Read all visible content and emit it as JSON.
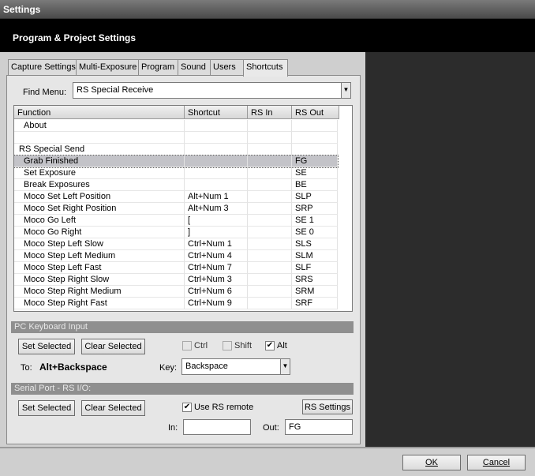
{
  "window": {
    "title": "Settings"
  },
  "header": {
    "title": "Program & Project Settings"
  },
  "tabs": [
    {
      "label": "Capture Settings"
    },
    {
      "label": "Multi-Exposure"
    },
    {
      "label": "Program"
    },
    {
      "label": "Sound"
    },
    {
      "label": "Users"
    },
    {
      "label": "Shortcuts"
    }
  ],
  "active_tab": "Shortcuts",
  "find_menu": {
    "label": "Find Menu:",
    "value": "RS Special Receive"
  },
  "grid": {
    "columns": [
      "Function",
      "Shortcut",
      "RS In",
      "RS Out"
    ],
    "rows": [
      {
        "function": "About",
        "shortcut": "",
        "rs_in": "",
        "rs_out": ""
      },
      {
        "function": "",
        "shortcut": "",
        "rs_in": "",
        "rs_out": ""
      },
      {
        "function": "RS Special Send",
        "shortcut": "",
        "rs_in": "",
        "rs_out": ""
      },
      {
        "function": "Grab Finished",
        "shortcut": "",
        "rs_in": "",
        "rs_out": "FG",
        "selected": true
      },
      {
        "function": "Set Exposure",
        "shortcut": "",
        "rs_in": "",
        "rs_out": "SE"
      },
      {
        "function": "Break Exposures",
        "shortcut": "",
        "rs_in": "",
        "rs_out": "BE"
      },
      {
        "function": "Moco Set Left Position",
        "shortcut": "Alt+Num 1",
        "rs_in": "",
        "rs_out": "SLP"
      },
      {
        "function": "Moco Set Right Position",
        "shortcut": "Alt+Num 3",
        "rs_in": "",
        "rs_out": "SRP"
      },
      {
        "function": "Moco Go Left",
        "shortcut": "[",
        "rs_in": "",
        "rs_out": "SE 1"
      },
      {
        "function": "Moco Go Right",
        "shortcut": "]",
        "rs_in": "",
        "rs_out": "SE 0"
      },
      {
        "function": "Moco Step Left Slow",
        "shortcut": "Ctrl+Num 1",
        "rs_in": "",
        "rs_out": "SLS"
      },
      {
        "function": "Moco Step Left Medium",
        "shortcut": "Ctrl+Num 4",
        "rs_in": "",
        "rs_out": "SLM"
      },
      {
        "function": "Moco Step Left Fast",
        "shortcut": "Ctrl+Num 7",
        "rs_in": "",
        "rs_out": "SLF"
      },
      {
        "function": "Moco Step Right Slow",
        "shortcut": "Ctrl+Num 3",
        "rs_in": "",
        "rs_out": "SRS"
      },
      {
        "function": "Moco Step Right Medium",
        "shortcut": "Ctrl+Num 6",
        "rs_in": "",
        "rs_out": "SRM"
      },
      {
        "function": "Moco Step Right Fast",
        "shortcut": "Ctrl+Num 9",
        "rs_in": "",
        "rs_out": "SRF"
      }
    ],
    "scroll_position": 0.72
  },
  "keyboard": {
    "section_title": "PC Keyboard Input",
    "set_label": "Set Selected",
    "clear_label": "Clear Selected",
    "ctrl_label": "Ctrl",
    "ctrl_checked": false,
    "shift_label": "Shift",
    "shift_checked": false,
    "alt_label": "Alt",
    "alt_checked": true,
    "to_label": "To:",
    "to_value": "Alt+Backspace",
    "key_label": "Key:",
    "key_value": "Backspace"
  },
  "serial": {
    "section_title": "Serial Port - RS I/O:",
    "set_label": "Set Selected",
    "clear_label": "Clear Selected",
    "use_rs_label": "Use RS remote",
    "use_rs_checked": true,
    "rs_settings_label": "RS Settings",
    "in_label": "In:",
    "in_value": "",
    "out_label": "Out:",
    "out_value": "FG"
  },
  "footer": {
    "ok_label": "OK",
    "cancel_label": "Cancel"
  },
  "glyphs": {
    "check": "✔",
    "down": "▼",
    "up": "▲"
  }
}
